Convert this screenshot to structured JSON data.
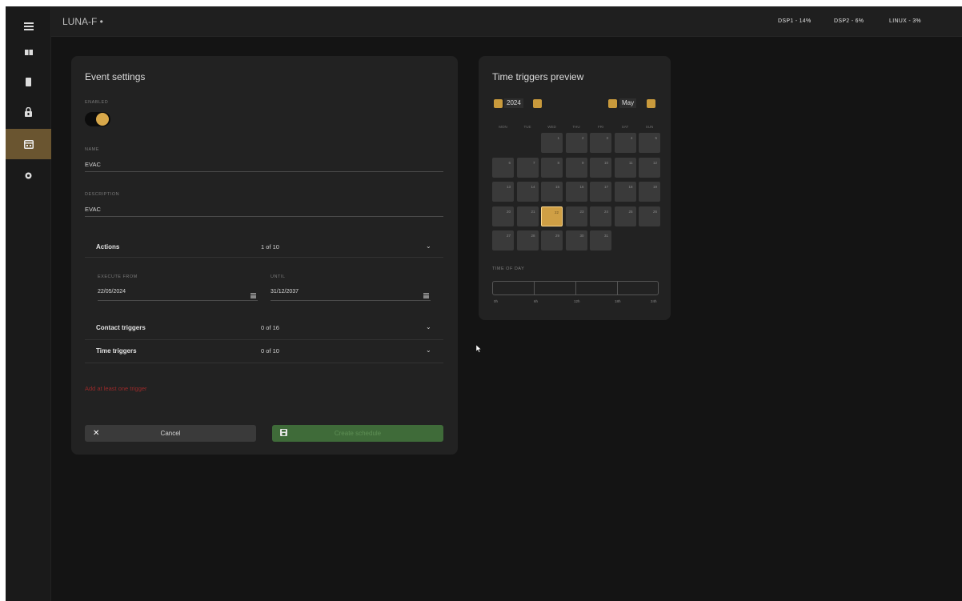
{
  "app": {
    "title": "LUNA-F •",
    "stats": [
      "DSP1 - 14%",
      "DSP2 - 6%",
      "LINUX - 3%"
    ]
  },
  "sidebar": {
    "items": [
      {
        "icon": "menu-icon"
      },
      {
        "icon": "grid-icon"
      },
      {
        "icon": "device-icon"
      },
      {
        "icon": "lock-icon"
      },
      {
        "icon": "calendar-icon",
        "active": true
      },
      {
        "icon": "settings-icon"
      }
    ]
  },
  "event": {
    "title": "Event settings",
    "enabled_label": "ENABLED",
    "enabled": true,
    "name_label": "NAME",
    "name_value": "EVAC",
    "description_label": "DESCRIPTION",
    "description_value": "EVAC",
    "actions_label": "Actions",
    "actions_count": "1 of 10",
    "execute_from_label": "EXECUTE FROM",
    "execute_from_value": "22/05/2024",
    "until_label": "UNTIL",
    "until_value": "31/12/2037",
    "contact_label": "Contact triggers",
    "contact_count": "0 of 16",
    "time_label": "Time triggers",
    "time_count": "0 of 10",
    "error": "Add at least one trigger",
    "cancel_label": "Cancel",
    "create_label": "Create schedule"
  },
  "calendar": {
    "title": "Time triggers preview",
    "year": "2024",
    "month": "May",
    "weekdays": [
      "MON",
      "TUE",
      "WED",
      "THU",
      "FRI",
      "SAT",
      "SUN"
    ],
    "days": [
      "1",
      "2",
      "3",
      "4",
      "5",
      "6",
      "7",
      "8",
      "9",
      "10",
      "11",
      "12",
      "13",
      "14",
      "15",
      "16",
      "17",
      "18",
      "19",
      "20",
      "21",
      "22",
      "23",
      "24",
      "25",
      "26",
      "27",
      "28",
      "29",
      "30",
      "31"
    ],
    "first_weekday_index": 2,
    "selected_day": "22",
    "time_of_day_label": "TIME OF DAY",
    "time_labels": [
      "0h",
      "6h",
      "12h",
      "18h",
      "24h"
    ],
    "accent": "#cf9f45"
  }
}
